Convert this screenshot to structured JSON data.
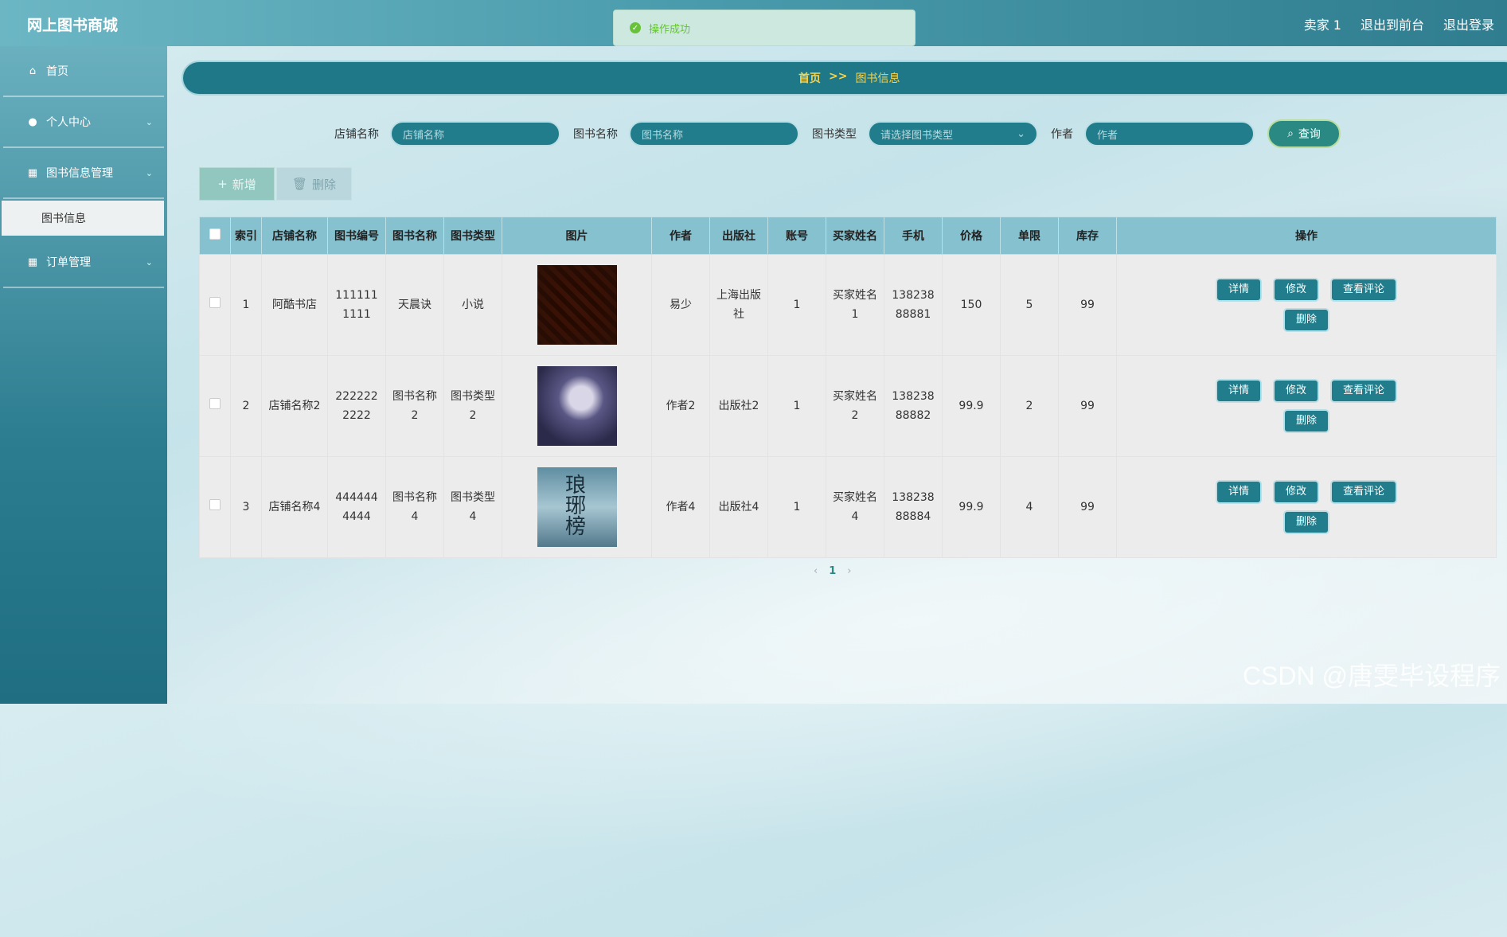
{
  "app": {
    "title": "网上图书商城"
  },
  "header": {
    "user": "卖家 1",
    "to_front": "退出到前台",
    "logout": "退出登录"
  },
  "toast": {
    "icon": "check-circle-icon",
    "message": "操作成功"
  },
  "sidebar": {
    "items": [
      {
        "label": "首页",
        "icon": "home-icon",
        "glyph": "⌂"
      },
      {
        "label": "个人中心",
        "icon": "user-icon",
        "glyph": "●"
      },
      {
        "label": "图书信息管理",
        "icon": "grid-icon",
        "glyph": "▦"
      },
      {
        "label": "订单管理",
        "icon": "grid-icon",
        "glyph": "▦"
      }
    ],
    "sub_items": [
      {
        "label": "图书信息"
      }
    ]
  },
  "breadcrumb": {
    "home": "首页",
    "sep": ">>",
    "current": "图书信息"
  },
  "search": {
    "shop_label": "店铺名称",
    "shop_placeholder": "店铺名称",
    "book_label": "图书名称",
    "book_placeholder": "图书名称",
    "type_label": "图书类型",
    "type_placeholder": "请选择图书类型",
    "author_label": "作者",
    "author_placeholder": "作者",
    "query_label": "查询"
  },
  "actions": {
    "add": "新增",
    "delete": "删除"
  },
  "table": {
    "columns": [
      "索引",
      "店铺名称",
      "图书编号",
      "图书名称",
      "图书类型",
      "图片",
      "作者",
      "出版社",
      "账号",
      "买家姓名",
      "手机",
      "价格",
      "单限",
      "库存",
      "操作"
    ],
    "rows": [
      {
        "index": "1",
        "shop": "阿酷书店",
        "code": "1111111111",
        "name": "天晨诀",
        "type": "小说",
        "author": "易少",
        "publisher": "上海出版社",
        "account": "1",
        "buyer": "买家姓名1",
        "phone": "13823888881",
        "price": "150",
        "limit": "5",
        "stock": "99"
      },
      {
        "index": "2",
        "shop": "店铺名称2",
        "code": "2222222222",
        "name": "图书名称2",
        "type": "图书类型2",
        "author": "作者2",
        "publisher": "出版社2",
        "account": "1",
        "buyer": "买家姓名2",
        "phone": "13823888882",
        "price": "99.9",
        "limit": "2",
        "stock": "99"
      },
      {
        "index": "3",
        "shop": "店铺名称4",
        "code": "4444444444",
        "name": "图书名称4",
        "type": "图书类型4",
        "author": "作者4",
        "publisher": "出版社4",
        "account": "1",
        "buyer": "买家姓名4",
        "phone": "13823888884",
        "price": "99.9",
        "limit": "4",
        "stock": "99"
      }
    ],
    "ops": {
      "detail": "详情",
      "edit": "修改",
      "comments": "查看评论",
      "delete": "删除"
    },
    "cover3_text": "琅琊榜"
  },
  "pager": {
    "prev": "‹",
    "current": "1",
    "next": "›"
  },
  "watermark": "CSDN @唐雯毕设程序"
}
